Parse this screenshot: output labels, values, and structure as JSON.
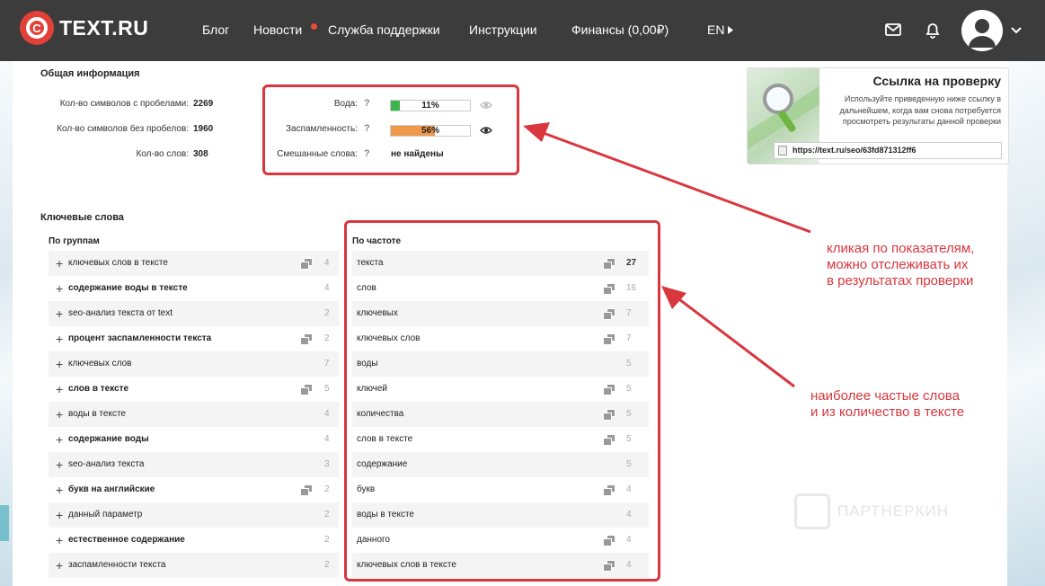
{
  "header": {
    "logo_text": "TEXT.RU",
    "logo_mark": "C",
    "nav": [
      "Блог",
      "Новости",
      "Служба поддержки",
      "Инструкции",
      "Финансы (0,00₽)",
      "EN"
    ],
    "news_dot_color": "#e74c3c",
    "icons": [
      "mail-icon",
      "bell-icon",
      "avatar-icon",
      "chevron-down-icon",
      "play-small-icon"
    ]
  },
  "general": {
    "title": "Общая информация",
    "stats": [
      {
        "label": "Кол-во символов с пробелами:",
        "value": "2269"
      },
      {
        "label": "Кол-во символов без пробелов:",
        "value": "1960"
      },
      {
        "label": "Кол-во слов:",
        "value": "308"
      }
    ],
    "metrics": {
      "water": {
        "label": "Вода:",
        "q": "?",
        "value_text": "11%",
        "fraction": 0.11,
        "color": "#3bb54a"
      },
      "spam": {
        "label": "Заспамленность:",
        "q": "?",
        "value_text": "56%",
        "fraction": 0.56,
        "color": "#ef9a4a"
      },
      "mixed": {
        "label": "Смешанные слова:",
        "q": "?",
        "value_text": "не найдены"
      }
    }
  },
  "promo": {
    "title": "Ссылка на проверку",
    "description": "Используйте приведенную ниже ссылку в дальнейшем, когда вам снова потребуется просмотреть результаты данной проверки",
    "link": "https://text.ru/seo/63fd871312ff6"
  },
  "keywords": {
    "title": "Ключевые слова",
    "groups_title": "По группам",
    "freq_title": "По частоте",
    "groups": [
      {
        "label": "ключевых слов в тексте",
        "count": "4",
        "bold": false,
        "copy": true
      },
      {
        "label": "содержание воды в тексте",
        "count": "4",
        "bold": true,
        "copy": false
      },
      {
        "label": "seo-анализ текста от text",
        "count": "2",
        "bold": false,
        "copy": false
      },
      {
        "label": "процент заспамленности текста",
        "count": "2",
        "bold": true,
        "copy": true
      },
      {
        "label": "ключевых слов",
        "count": "7",
        "bold": false,
        "copy": false
      },
      {
        "label": "слов в тексте",
        "count": "5",
        "bold": true,
        "copy": true
      },
      {
        "label": "воды в тексте",
        "count": "4",
        "bold": false,
        "copy": false
      },
      {
        "label": "содержание воды",
        "count": "4",
        "bold": true,
        "copy": false
      },
      {
        "label": "seo-анализ текста",
        "count": "3",
        "bold": false,
        "copy": false
      },
      {
        "label": "букв на английские",
        "count": "2",
        "bold": true,
        "copy": true
      },
      {
        "label": "данный параметр",
        "count": "2",
        "bold": false,
        "copy": false
      },
      {
        "label": "естественное содержание",
        "count": "2",
        "bold": true,
        "copy": false
      },
      {
        "label": "заспамленности текста",
        "count": "2",
        "bold": false,
        "copy": false
      }
    ],
    "frequency": [
      {
        "label": "текста",
        "count": "27",
        "copy": true,
        "dark": true
      },
      {
        "label": "слов",
        "count": "16",
        "copy": true,
        "dark": false
      },
      {
        "label": "ключевых",
        "count": "7",
        "copy": true,
        "dark": false
      },
      {
        "label": "ключевых слов",
        "count": "7",
        "copy": true,
        "dark": false
      },
      {
        "label": "воды",
        "count": "5",
        "copy": false,
        "dark": false
      },
      {
        "label": "ключей",
        "count": "5",
        "copy": true,
        "dark": false
      },
      {
        "label": "количества",
        "count": "5",
        "copy": true,
        "dark": false
      },
      {
        "label": "слов в тексте",
        "count": "5",
        "copy": true,
        "dark": false
      },
      {
        "label": "содержание",
        "count": "5",
        "copy": false,
        "dark": false
      },
      {
        "label": "букв",
        "count": "4",
        "copy": true,
        "dark": false
      },
      {
        "label": "воды в тексте",
        "count": "4",
        "copy": false,
        "dark": false
      },
      {
        "label": "данного",
        "count": "4",
        "copy": true,
        "dark": false
      },
      {
        "label": "ключевых слов в тексте",
        "count": "4",
        "copy": true,
        "dark": false
      }
    ]
  },
  "annotations": {
    "first": [
      "кликая по показателям,",
      "можно отслеживать их",
      "в результатах проверки"
    ],
    "second": [
      "наиболее частые слова",
      "и из количество в тексте"
    ],
    "color": "#d9363e"
  },
  "watermark": "ПАРТНЕРКИН"
}
